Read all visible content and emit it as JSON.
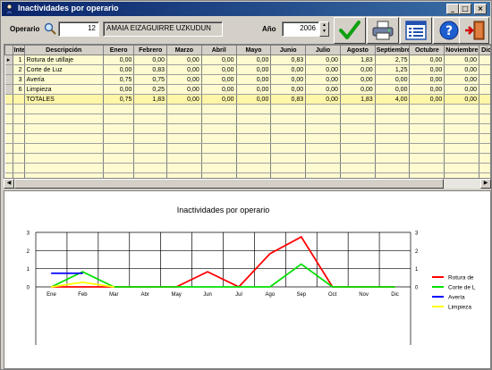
{
  "window": {
    "title": "Inactividades por operario"
  },
  "filters": {
    "operario_label": "Operario",
    "operario_code": "12",
    "operario_name": "AMAIA EIZAGUIRRE UZKUDUN",
    "ano_label": "Año",
    "ano_value": "2006"
  },
  "toolbar": {
    "icons": [
      "check-icon",
      "printer-icon",
      "list-icon",
      "help-icon",
      "exit-icon"
    ]
  },
  "grid": {
    "columns": [
      "Inte",
      "Descripción",
      "Enero",
      "Febrero",
      "Marzo",
      "Abril",
      "Mayo",
      "Junio",
      "Julio",
      "Agosto",
      "Septiembre",
      "Octubre",
      "Noviembre",
      "Diciembre"
    ],
    "rows": [
      [
        "1",
        "Rotura de utillaje",
        "0,00",
        "0,00",
        "0,00",
        "0,00",
        "0,00",
        "0,83",
        "0,00",
        "1,83",
        "2,75",
        "0,00",
        "0,00",
        "0,00"
      ],
      [
        "2",
        "Corte de Luz",
        "0,00",
        "0,83",
        "0,00",
        "0,00",
        "0,00",
        "0,00",
        "0,00",
        "0,00",
        "1,25",
        "0,00",
        "0,00",
        "0,00"
      ],
      [
        "3",
        "Avería",
        "0,75",
        "0,75",
        "0,00",
        "0,00",
        "0,00",
        "0,00",
        "0,00",
        "0,00",
        "0,00",
        "0,00",
        "0,00",
        "0,00"
      ],
      [
        "6",
        "Limpieza",
        "0,00",
        "0,25",
        "0,00",
        "0,00",
        "0,00",
        "0,00",
        "0,00",
        "0,00",
        "0,00",
        "0,00",
        "0,00",
        "0,00"
      ]
    ],
    "totals": [
      "",
      "TOTALES",
      "0,75",
      "1,83",
      "0,00",
      "0,00",
      "0,00",
      "0,83",
      "0,00",
      "1,83",
      "4,00",
      "0,00",
      "0,00",
      "0,00"
    ]
  },
  "chart_data": {
    "type": "line",
    "title": "Inactividades por operario",
    "categories": [
      "Ene",
      "Feb",
      "Mar",
      "Abr",
      "May",
      "Jun",
      "Jul",
      "Ago",
      "Sep",
      "Oct",
      "Nov",
      "Dic"
    ],
    "series": [
      {
        "name": "Rotura de",
        "color": "#ff0000",
        "values": [
          0,
          0,
          0,
          0,
          0,
          0.83,
          0,
          1.83,
          2.75,
          0,
          0,
          0
        ]
      },
      {
        "name": "Corte de L",
        "color": "#00e000",
        "values": [
          0,
          0.83,
          0,
          0,
          0,
          0,
          0,
          0,
          1.25,
          0,
          0,
          0
        ]
      },
      {
        "name": "Avería",
        "color": "#0000ff",
        "values": [
          0.75,
          0.75,
          null,
          null,
          null,
          null,
          null,
          null,
          null,
          null,
          null,
          null
        ]
      },
      {
        "name": "Limpieza",
        "color": "#ffff00",
        "values": [
          0,
          0.25,
          0,
          null,
          null,
          null,
          null,
          null,
          null,
          null,
          null,
          null
        ]
      }
    ],
    "ylim": [
      0,
      3
    ],
    "yticks": [
      "0",
      "1",
      "2",
      "3"
    ],
    "grid": true,
    "legend": "right"
  }
}
